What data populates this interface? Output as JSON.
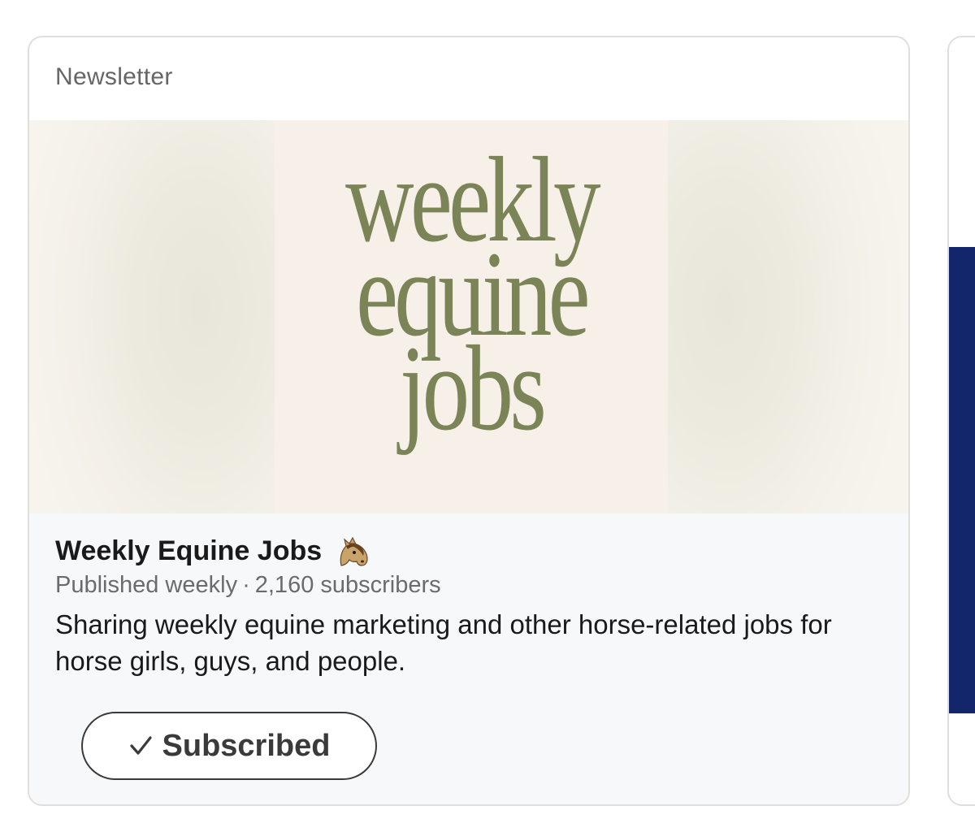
{
  "card": {
    "header_label": "Newsletter",
    "banner": {
      "logo_lines": [
        "weekly",
        "equine",
        "jobs"
      ],
      "logo_color": "#7b8457"
    },
    "newsletter": {
      "title": "Weekly Equine Jobs",
      "title_icon": "horse-face-icon",
      "frequency": "Published weekly",
      "separator": "·",
      "subscribers": "2,160 subscribers",
      "description": "Sharing weekly equine marketing and other horse-related jobs for horse girls, guys, and people."
    },
    "subscribe_button": {
      "icon": "checkmark-icon",
      "label": "Subscribed"
    }
  },
  "next_card": {
    "image_color": "#14266b"
  }
}
